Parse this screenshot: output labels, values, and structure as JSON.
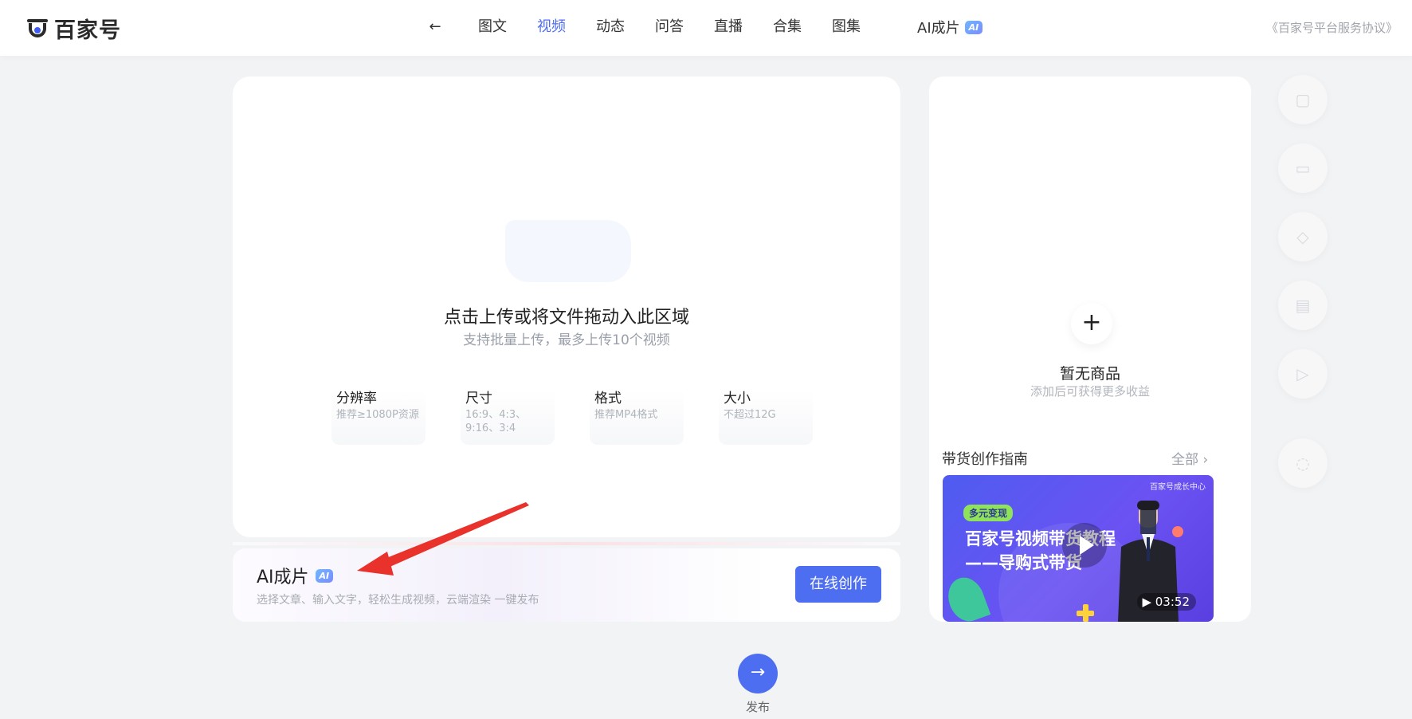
{
  "header": {
    "logo_text": "百家号",
    "back_icon": "arrow-left-icon",
    "nav": [
      {
        "label": "图文",
        "active": false
      },
      {
        "label": "视频",
        "active": true
      },
      {
        "label": "动态",
        "active": false
      },
      {
        "label": "问答",
        "active": false
      },
      {
        "label": "直播",
        "active": false
      },
      {
        "label": "合集",
        "active": false
      },
      {
        "label": "图集",
        "active": false
      }
    ],
    "ai_nav_label": "AI成片",
    "ai_badge": "AI",
    "agreement": "《百家号平台服务协议》"
  },
  "upload": {
    "title": "点击上传或将文件拖动入此区域",
    "subtitle": "支持批量上传，最多上传10个视频",
    "specs": [
      {
        "key": "分辨率",
        "value": "推荐≥1080P资源"
      },
      {
        "key": "尺寸",
        "value": "16:9、4:3、9:16、3:4"
      },
      {
        "key": "格式",
        "value": "推荐MP4格式"
      },
      {
        "key": "大小",
        "value": "不超过12G"
      }
    ]
  },
  "ai_panel": {
    "title": "AI成片",
    "badge": "AI",
    "description": "选择文章、输入文字，轻松生成视频，云端渲染 一键发布",
    "button": "在线创作"
  },
  "goods": {
    "empty_title": "暂无商品",
    "empty_sub": "添加后可获得更多收益",
    "guide_title": "带货创作指南",
    "guide_all": "全部 ›",
    "video": {
      "brand": "百家号成长中心",
      "tag": "多元变现",
      "title_line1": "百家号视频带货教程",
      "title_line2": "——导购式带货",
      "duration": "03:52"
    }
  },
  "side_tools": [
    "calendar-icon",
    "bookmark-icon",
    "diamond-icon",
    "note-icon",
    "play-icon",
    "chat-icon"
  ],
  "publish": {
    "label": "发布"
  },
  "colors": {
    "accent": "#4e6ef2",
    "background": "#f2f3f5",
    "annotation": "#e8322b"
  }
}
